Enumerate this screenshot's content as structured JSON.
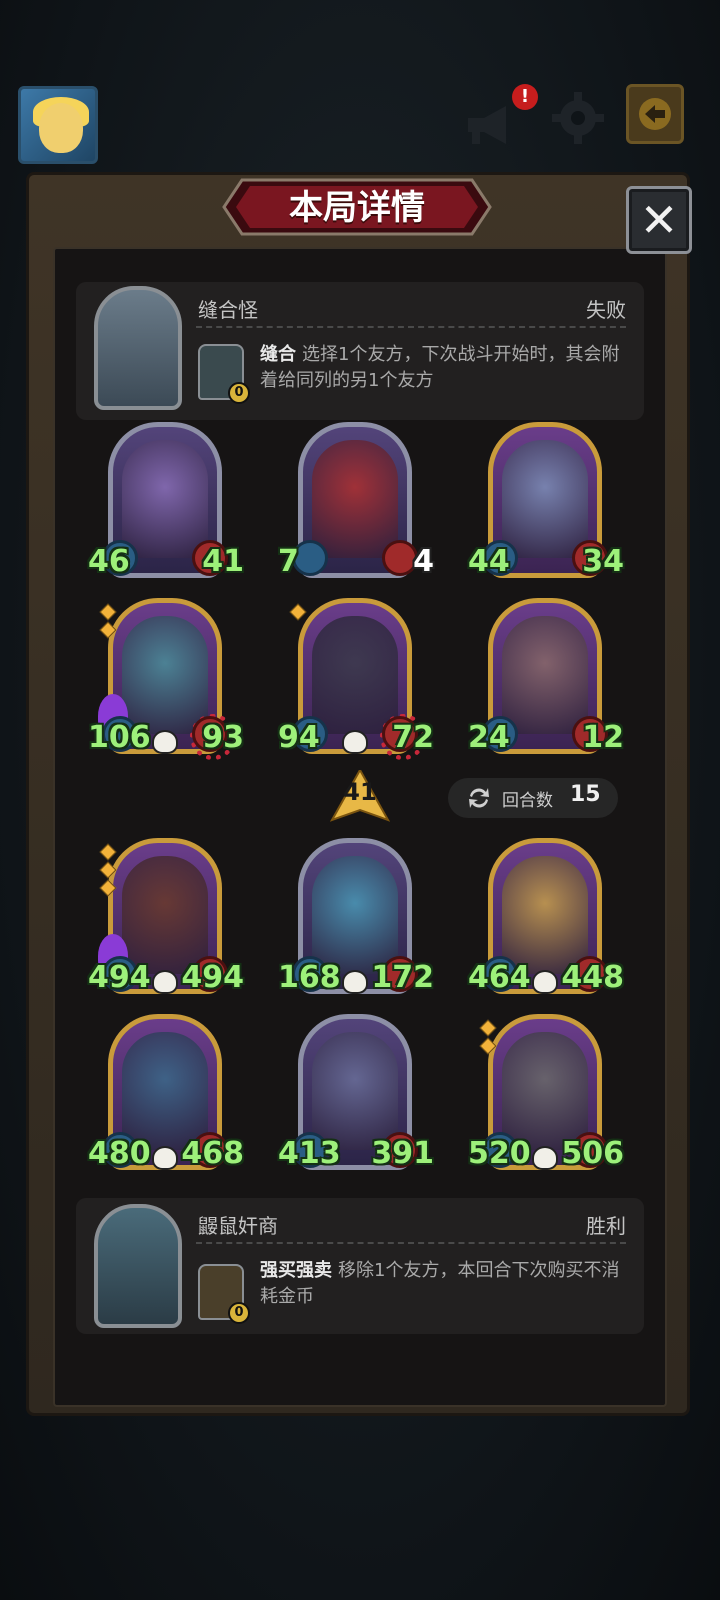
{
  "window_title": "本局详情",
  "opponent": {
    "name": "缝合怪",
    "result": "失败",
    "skill_name": "缝合",
    "skill_desc": "选择1个友方，下次战斗开始时，其会附着给同列的另1个友方",
    "cost": "0"
  },
  "opponent_cards": [
    {
      "atk": "46",
      "hp": "41",
      "frame": "silver",
      "art": "#8a6fb8"
    },
    {
      "atk": "7",
      "hp": "4",
      "frame": "silver",
      "art": "#b03030"
    },
    {
      "atk": "44",
      "hp": "34",
      "frame": "gold",
      "art": "#7d8fb8"
    },
    {
      "atk": "106",
      "hp": "93",
      "frame": "gold",
      "art": "#4a8f9a"
    },
    {
      "atk": "94",
      "hp": "72",
      "frame": "gold",
      "art": "#3a3a4a"
    },
    {
      "atk": "24",
      "hp": "12",
      "frame": "gold",
      "art": "#8a6a6a"
    }
  ],
  "damage_indicator": "41",
  "turns": {
    "label": "回合数",
    "value": "15"
  },
  "player_cards": [
    {
      "atk": "494",
      "hp": "494",
      "frame": "gold",
      "art": "#6a3a2a"
    },
    {
      "atk": "168",
      "hp": "172",
      "frame": "silver",
      "art": "#4a9ab8"
    },
    {
      "atk": "464",
      "hp": "448",
      "frame": "gold",
      "art": "#c8a04a"
    },
    {
      "atk": "480",
      "hp": "468",
      "frame": "gold",
      "art": "#3a6a8a"
    },
    {
      "atk": "413",
      "hp": "391",
      "frame": "silver",
      "art": "#6a6f9a"
    },
    {
      "atk": "520",
      "hp": "506",
      "frame": "gold",
      "art": "#6a6a6a"
    }
  ],
  "player": {
    "name": "鼹鼠奸商",
    "result": "胜利",
    "skill_name": "强买强卖",
    "skill_desc": "移除1个友方，本回合下次购买不消耗金币",
    "cost": "0"
  },
  "colors": {
    "stat_green": "#9df07a",
    "gold_frame": "#c99b3b",
    "silver_frame": "#8d8fa6"
  }
}
